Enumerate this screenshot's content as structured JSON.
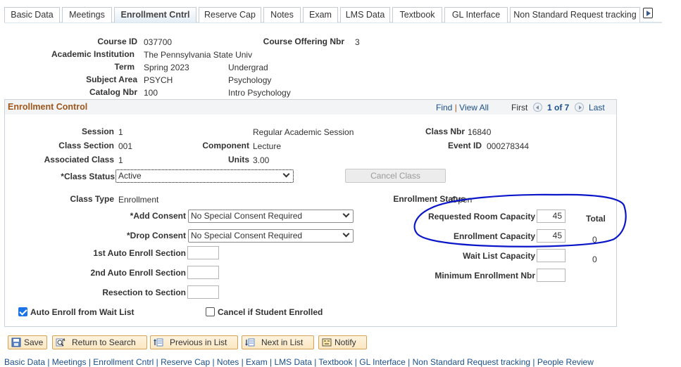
{
  "tabs": [
    {
      "label": "Basic Data",
      "active": false
    },
    {
      "label": "Meetings",
      "active": false
    },
    {
      "label": "Enrollment Cntrl",
      "active": true
    },
    {
      "label": "Reserve Cap",
      "active": false
    },
    {
      "label": "Notes",
      "active": false
    },
    {
      "label": "Exam",
      "active": false
    },
    {
      "label": "LMS Data",
      "active": false
    },
    {
      "label": "Textbook",
      "active": false
    },
    {
      "label": "GL Interface",
      "active": false
    },
    {
      "label": "Non Standard Request tracking",
      "active": false
    }
  ],
  "header": {
    "course_id_label": "Course ID",
    "course_id": "037700",
    "offering_label": "Course Offering Nbr",
    "offering": "3",
    "institution_label": "Academic Institution",
    "institution": "The Pennsylvania State Univ",
    "term_label": "Term",
    "term": "Spring 2023",
    "career": "Undergrad",
    "subject_label": "Subject Area",
    "subject": "PSYCH",
    "subject_desc": "Psychology",
    "catalog_label": "Catalog Nbr",
    "catalog": "100",
    "catalog_desc": "Intro Psychology"
  },
  "section": {
    "title": "Enrollment Control",
    "find": "Find",
    "view_all": "View All",
    "sep": "|",
    "first": "First",
    "position": "1 of 7",
    "last": "Last"
  },
  "fields": {
    "session_label": "Session",
    "session": "1",
    "session_desc": "Regular Academic Session",
    "class_nbr_label": "Class Nbr",
    "class_nbr": "16840",
    "class_section_label": "Class Section",
    "class_section": "001",
    "component_label": "Component",
    "component": "Lecture",
    "event_id_label": "Event ID",
    "event_id": "000278344",
    "assoc_class_label": "Associated Class",
    "assoc_class": "1",
    "units_label": "Units",
    "units": "3.00",
    "class_status_label": "*Class Status",
    "class_status": "Active",
    "cancel_class": "Cancel Class",
    "class_type_label": "Class Type",
    "class_type": "Enrollment",
    "enroll_status_label": "Enrollment Status",
    "enroll_status": "Open",
    "add_consent_label": "*Add Consent",
    "add_consent": "No Special Consent Required",
    "drop_consent_label": "*Drop Consent",
    "drop_consent": "No Special Consent Required",
    "auto1_label": "1st Auto Enroll Section",
    "auto1": "",
    "auto2_label": "2nd Auto Enroll Section",
    "auto2": "",
    "resection_label": "Resection to Section",
    "resection": "",
    "req_room_label": "Requested Room Capacity",
    "req_room": "45",
    "enroll_cap_label": "Enrollment Capacity",
    "enroll_cap": "45",
    "waitlist_cap_label": "Wait List Capacity",
    "waitlist_cap": "",
    "min_enroll_label": "Minimum Enrollment Nbr",
    "min_enroll": "",
    "total_label": "Total",
    "enroll_total": "0",
    "waitlist_total": "0",
    "auto_enroll_wl_label": "Auto Enroll from Wait List",
    "auto_enroll_wl": true,
    "cancel_if_enrolled_label": "Cancel if Student Enrolled",
    "cancel_if_enrolled": false
  },
  "toolbar": {
    "save": "Save",
    "return_search": "Return to Search",
    "prev_list": "Previous in List",
    "next_list": "Next in List",
    "notify": "Notify"
  },
  "footer": {
    "links": "Basic Data | Meetings | Enrollment Cntrl | Reserve Cap | Notes | Exam | LMS Data | Textbook | GL Interface | Non Standard Request tracking | People Review"
  },
  "colors": {
    "section_title": "#a0561a",
    "link": "#1c4f8a",
    "annotation": "#0a16c8",
    "toolbar_border": "#d6a255"
  }
}
